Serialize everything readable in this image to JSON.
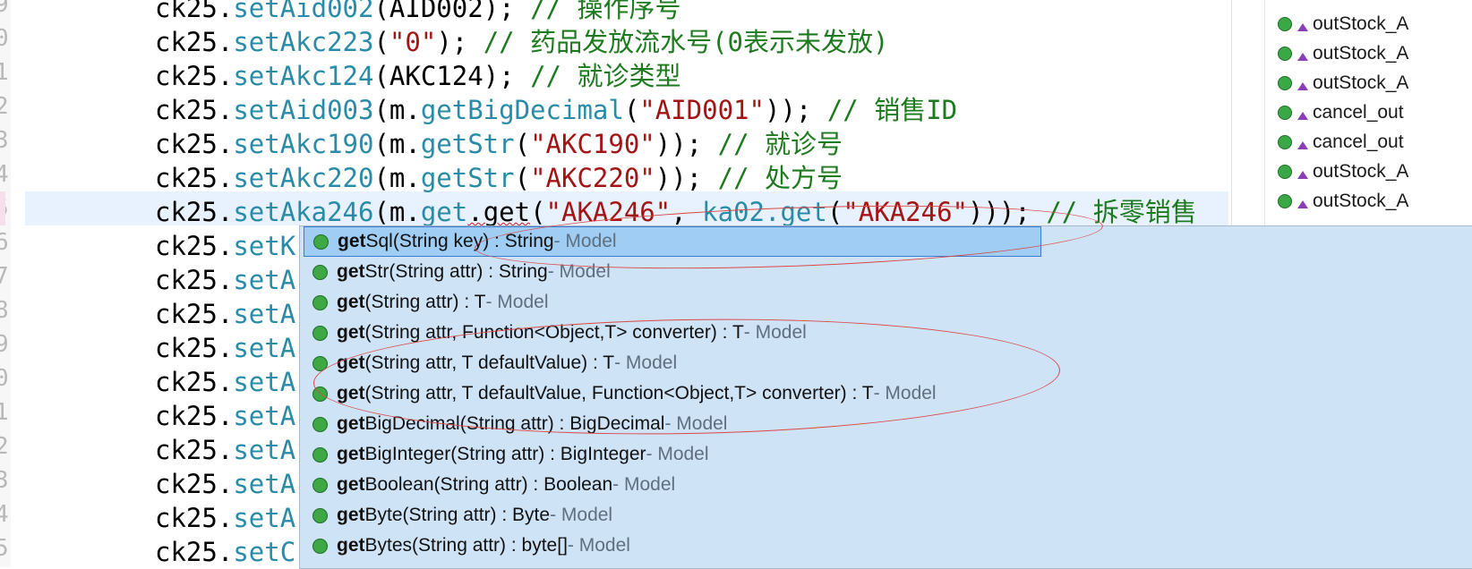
{
  "editor": {
    "gutter_numbers": [
      "9",
      "0",
      "1",
      "2",
      "3",
      "4",
      "5",
      "6",
      "7",
      "8",
      "9",
      "0",
      "1",
      "2",
      "3",
      "4",
      "5"
    ],
    "lines": [
      {
        "obj": "ck25.",
        "method": "setAid002",
        "open": "(",
        "arg": "AID002",
        "close": ");",
        "comment": " // 操作序号"
      },
      {
        "obj": "ck25.",
        "method": "setAkc223",
        "open": "(",
        "str": "\"0\"",
        "close": ");",
        "comment": " // 药品发放流水号(0表示未发放)"
      },
      {
        "obj": "ck25.",
        "method": "setAkc124",
        "open": "(",
        "arg": "AKC124",
        "close": ");",
        "comment": " // 就诊类型"
      },
      {
        "obj": "ck25.",
        "method": "setAid003",
        "open": "(",
        "call_obj": "m.",
        "call": "getBigDecimal",
        "str": "\"AID001\"",
        "close": "));",
        "comment": " // 销售ID"
      },
      {
        "obj": "ck25.",
        "method": "setAkc190",
        "open": "(",
        "call_obj": "m.",
        "call": "getStr",
        "str": "\"AKC190\"",
        "close": "));",
        "comment": " // 就诊号"
      },
      {
        "obj": "ck25.",
        "method": "setAkc220",
        "open": "(",
        "call_obj": "m.",
        "call": "getStr",
        "str": "\"AKC220\"",
        "close": "));",
        "comment": " // 处方号"
      },
      {
        "obj": "ck25.",
        "method": "setAka246",
        "open": "(",
        "call_obj": "m.",
        "call": "get",
        "dot_get": ".get",
        "str": "\"AKA246\"",
        "sep": ", ",
        "arg2_obj": "ka02.",
        "arg2_call": "get",
        "str2": "\"AKA246\"",
        "close": ")));",
        "comment": " // 拆零销售"
      },
      {
        "obj": "ck25.",
        "method": "setK"
      },
      {
        "obj": "ck25.",
        "method": "setA"
      },
      {
        "obj": "ck25.",
        "method": "setA"
      },
      {
        "obj": "ck25.",
        "method": "setA"
      },
      {
        "obj": "ck25.",
        "method": "setA"
      },
      {
        "obj": "ck25.",
        "method": "setA"
      },
      {
        "obj": "ck25.",
        "method": "setA"
      },
      {
        "obj": "ck25.",
        "method": "setA"
      },
      {
        "obj": "ck25.",
        "method": "setA"
      },
      {
        "obj": "ck25.",
        "method": "setC"
      }
    ]
  },
  "outline": {
    "items": [
      {
        "label": "outStock_A"
      },
      {
        "label": "outStock_A"
      },
      {
        "label": "outStock_A"
      },
      {
        "label": "cancel_out"
      },
      {
        "label": "cancel_out"
      },
      {
        "label": "outStock_A"
      },
      {
        "label": "outStock_A"
      }
    ],
    "colors": {
      "field_dot": "#39a845",
      "modifier_triangle": "#8a3fb8"
    }
  },
  "autocomplete": {
    "selected_index": 0,
    "items": [
      {
        "bold": "get",
        "rest": "Sql(String key) : String",
        "owner": " - Model"
      },
      {
        "bold": "get",
        "rest": "Str(String attr) : String",
        "owner": " - Model"
      },
      {
        "bold": "get",
        "rest": "(String attr) : T",
        "owner": " - Model"
      },
      {
        "bold": "get",
        "rest": "(String attr, Function<Object,T> converter) : T",
        "owner": " - Model"
      },
      {
        "bold": "get",
        "rest": "(String attr, T defaultValue) : T",
        "owner": " - Model"
      },
      {
        "bold": "get",
        "rest": "(String attr, T defaultValue, Function<Object,T> converter) : T",
        "owner": " - Model"
      },
      {
        "bold": "get",
        "rest": "BigDecimal(String attr) : BigDecimal",
        "owner": " - Model"
      },
      {
        "bold": "get",
        "rest": "BigInteger(String attr) : BigInteger",
        "owner": " - Model"
      },
      {
        "bold": "get",
        "rest": "Boolean(String attr) : Boolean",
        "owner": " - Model"
      },
      {
        "bold": "get",
        "rest": "Byte(String attr) : Byte",
        "owner": " - Model"
      },
      {
        "bold": "get",
        "rest": "Bytes(String attr) : byte[]",
        "owner": " - Model"
      }
    ],
    "colors": {
      "background": "#cfe3f6",
      "selected": "#9fcdf3",
      "method_icon": "#3ea845",
      "annotation": "#d94848"
    }
  }
}
